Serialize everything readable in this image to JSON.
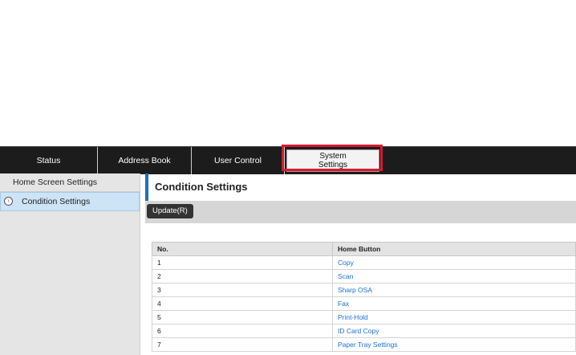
{
  "tabs": [
    {
      "label": "Status"
    },
    {
      "label": "Address Book"
    },
    {
      "label": "User Control"
    },
    {
      "label": "System\nSettings",
      "active": true
    }
  ],
  "sidebar": {
    "items": [
      {
        "label": "Home Screen Settings",
        "selected": false
      },
      {
        "label": "Condition Settings",
        "selected": true
      }
    ]
  },
  "main": {
    "title": "Condition Settings",
    "update_button": "Update(R)",
    "table": {
      "headers": [
        "No.",
        "Home Button"
      ],
      "rows": [
        {
          "no": "1",
          "button": "Copy"
        },
        {
          "no": "2",
          "button": "Scan"
        },
        {
          "no": "3",
          "button": "Sharp OSA"
        },
        {
          "no": "4",
          "button": "Fax"
        },
        {
          "no": "5",
          "button": "Print-Hold"
        },
        {
          "no": "6",
          "button": "ID Card Copy"
        },
        {
          "no": "7",
          "button": "Paper Tray Settings"
        }
      ]
    }
  },
  "colors": {
    "tabbar_bg": "#1c1c1c",
    "accent_blue": "#1f6fc1",
    "link_blue": "#1a6fd8",
    "highlight_red": "#d8192f",
    "selected_bg": "#cde3f6"
  },
  "icons": {
    "sidebar_selected_bullet": "chevron-circle-icon"
  }
}
